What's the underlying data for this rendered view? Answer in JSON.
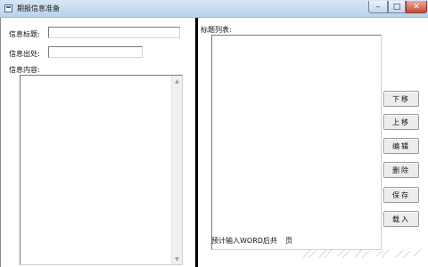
{
  "window": {
    "title": "期报信息准备",
    "controls": {
      "minimize": "–",
      "maximize": "□",
      "close": "✕"
    }
  },
  "left": {
    "title_label": "信息标题:",
    "title_value": "",
    "source_label": "信息出处:",
    "source_value": "",
    "content_label": "信息内容:",
    "content_value": ""
  },
  "right": {
    "list_label": "标题列表:",
    "buttons": {
      "move_down": "下移",
      "move_up": "上移",
      "edit": "编辑",
      "delete": "删除",
      "save": "保存",
      "import": "载入"
    },
    "status_text": "预计输入WORD后共",
    "page_unit": "页"
  },
  "icons": {
    "app": "window-icon",
    "scroll_up": "scroll-up-arrow-icon",
    "scroll_down": "scroll-down-arrow-icon"
  },
  "colors": {
    "titlebar": "#c7dcf1",
    "close": "#c84a35",
    "divider": "#000000"
  }
}
